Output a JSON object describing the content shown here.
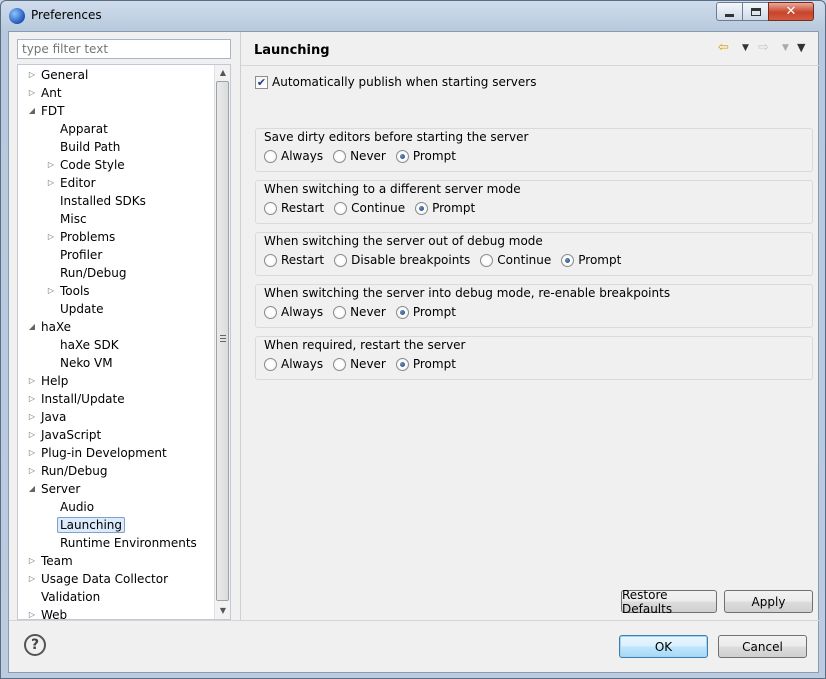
{
  "window": {
    "title": "Preferences"
  },
  "filter": {
    "placeholder": "type filter text"
  },
  "tree": [
    {
      "label": "General",
      "expand": "collapsed",
      "level": 0
    },
    {
      "label": "Ant",
      "expand": "collapsed",
      "level": 0
    },
    {
      "label": "FDT",
      "expand": "expanded",
      "level": 0
    },
    {
      "label": "Apparat",
      "expand": "none",
      "level": 1
    },
    {
      "label": "Build Path",
      "expand": "none",
      "level": 1
    },
    {
      "label": "Code Style",
      "expand": "collapsed",
      "level": 1
    },
    {
      "label": "Editor",
      "expand": "collapsed",
      "level": 1
    },
    {
      "label": "Installed SDKs",
      "expand": "none",
      "level": 1
    },
    {
      "label": "Misc",
      "expand": "none",
      "level": 1
    },
    {
      "label": "Problems",
      "expand": "collapsed",
      "level": 1
    },
    {
      "label": "Profiler",
      "expand": "none",
      "level": 1
    },
    {
      "label": "Run/Debug",
      "expand": "none",
      "level": 1
    },
    {
      "label": "Tools",
      "expand": "collapsed",
      "level": 1
    },
    {
      "label": "Update",
      "expand": "none",
      "level": 1
    },
    {
      "label": "haXe",
      "expand": "expanded",
      "level": 0
    },
    {
      "label": "haXe SDK",
      "expand": "none",
      "level": 1
    },
    {
      "label": "Neko VM",
      "expand": "none",
      "level": 1
    },
    {
      "label": "Help",
      "expand": "collapsed",
      "level": 0
    },
    {
      "label": "Install/Update",
      "expand": "collapsed",
      "level": 0
    },
    {
      "label": "Java",
      "expand": "collapsed",
      "level": 0
    },
    {
      "label": "JavaScript",
      "expand": "collapsed",
      "level": 0
    },
    {
      "label": "Plug-in Development",
      "expand": "collapsed",
      "level": 0
    },
    {
      "label": "Run/Debug",
      "expand": "collapsed",
      "level": 0
    },
    {
      "label": "Server",
      "expand": "expanded",
      "level": 0
    },
    {
      "label": "Audio",
      "expand": "none",
      "level": 1
    },
    {
      "label": "Launching",
      "expand": "none",
      "level": 1,
      "selected": true
    },
    {
      "label": "Runtime Environments",
      "expand": "none",
      "level": 1
    },
    {
      "label": "Team",
      "expand": "collapsed",
      "level": 0
    },
    {
      "label": "Usage Data Collector",
      "expand": "collapsed",
      "level": 0
    },
    {
      "label": "Validation",
      "expand": "none",
      "level": 0
    },
    {
      "label": "Web",
      "expand": "collapsed",
      "level": 0
    }
  ],
  "page": {
    "title": "Launching",
    "auto_publish": {
      "label": "Automatically publish when starting servers",
      "checked": true
    },
    "groups": [
      {
        "title": "Save dirty editors before starting the server",
        "options": [
          "Always",
          "Never",
          "Prompt"
        ],
        "selected": "Prompt"
      },
      {
        "title": "When switching to a different server mode",
        "options": [
          "Restart",
          "Continue",
          "Prompt"
        ],
        "selected": "Prompt"
      },
      {
        "title": "When switching the server out of debug mode",
        "options": [
          "Restart",
          "Disable breakpoints",
          "Continue",
          "Prompt"
        ],
        "selected": "Prompt"
      },
      {
        "title": "When switching the server into debug mode, re-enable breakpoints",
        "options": [
          "Always",
          "Never",
          "Prompt"
        ],
        "selected": "Prompt"
      },
      {
        "title": "When required, restart the server",
        "options": [
          "Always",
          "Never",
          "Prompt"
        ],
        "selected": "Prompt"
      }
    ],
    "restore_defaults_label": "Restore Defaults",
    "apply_label": "Apply"
  },
  "footer": {
    "ok_label": "OK",
    "cancel_label": "Cancel"
  }
}
